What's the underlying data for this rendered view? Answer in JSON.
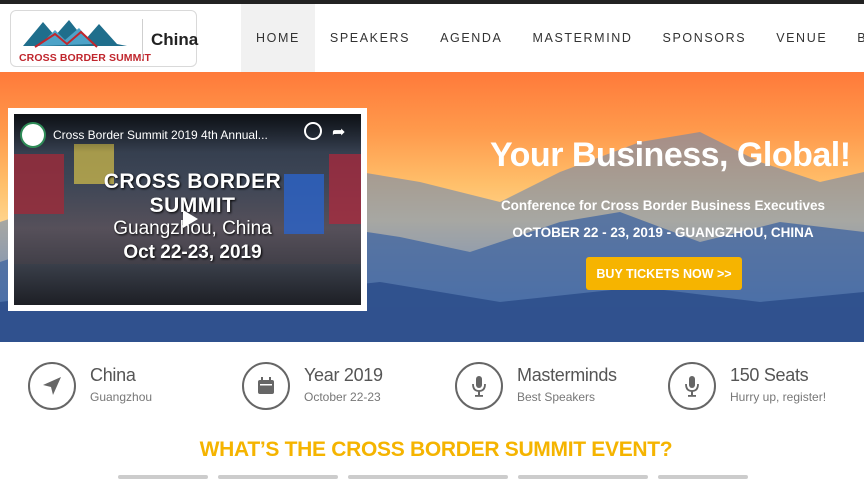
{
  "header": {
    "logo_text": "CROSS BORDER SUMMIT",
    "logo_city": "China",
    "nav": [
      {
        "label": "HOME",
        "active": true
      },
      {
        "label": "SPEAKERS",
        "active": false
      },
      {
        "label": "AGENDA",
        "active": false
      },
      {
        "label": "MASTERMIND",
        "active": false
      },
      {
        "label": "SPONSORS",
        "active": false
      },
      {
        "label": "VENUE",
        "active": false
      },
      {
        "label": "BUY",
        "active": false
      }
    ]
  },
  "video": {
    "title": "Cross Border Summit 2019 4th Annual...",
    "line1": "CROSS BORDER",
    "line2": "SUMMIT",
    "line3": "Guangzhou, China",
    "line4": "Oct 22-23, 2019"
  },
  "hero": {
    "title": "Your Business, Global!",
    "subtitle": "Conference for Cross Border Business Executives",
    "date": "OCTOBER 22 - 23, 2019 - GUANGZHOU, CHINA",
    "cta": "BUY TICKETS NOW >>"
  },
  "info": [
    {
      "icon": "location-arrow-icon",
      "title": "China",
      "sub": "Guangzhou"
    },
    {
      "icon": "calendar-icon",
      "title": "Year 2019",
      "sub": "October 22-23"
    },
    {
      "icon": "microphone-icon",
      "title": "Masterminds",
      "sub": "Best Speakers"
    },
    {
      "icon": "microphone-icon",
      "title": "150 Seats",
      "sub": "Hurry up, register!"
    }
  ],
  "section": {
    "heading": "WHAT’S THE CROSS BORDER SUMMIT EVENT?"
  },
  "colors": {
    "accent": "#f6b400",
    "logo_red": "#c0262d",
    "logo_teal": "#1f6e8c"
  }
}
